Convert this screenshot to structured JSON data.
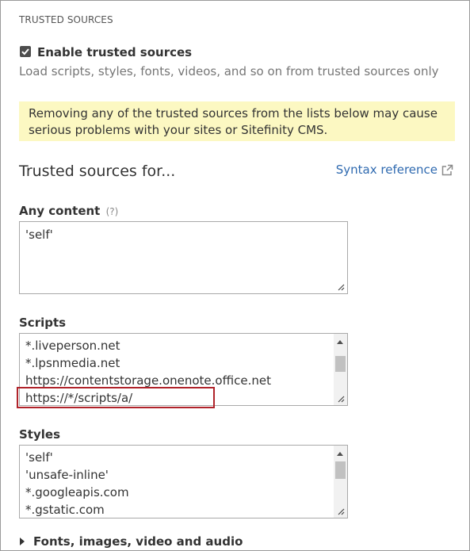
{
  "section_title": "TRUSTED SOURCES",
  "enable": {
    "label": "Enable trusted sources",
    "description": "Load scripts, styles, fonts, videos, and so on from trusted sources only",
    "checked": true
  },
  "warning": {
    "line1": "Removing any of the trusted sources from the lists below may cause",
    "line2": "serious problems with your sites or Sitefinity CMS."
  },
  "heading": "Trusted sources for...",
  "syntax_link": {
    "label": "Syntax reference",
    "icon": "external-link-icon"
  },
  "any_content": {
    "label": "Any content",
    "help": "(?)",
    "lines": [
      "'self'"
    ]
  },
  "scripts": {
    "label": "Scripts",
    "lines": [
      "*.liveperson.net",
      "*.lpsnmedia.net",
      "https://contentstorage.onenote.office.net",
      "https://*/scripts/a/"
    ]
  },
  "styles": {
    "label": "Styles",
    "lines": [
      "'self'",
      "'unsafe-inline'",
      "*.googleapis.com",
      "*.gstatic.com"
    ]
  },
  "fonts_section": {
    "label": "Fonts, images, video and audio",
    "icon": "caret-right-icon"
  },
  "colors": {
    "link": "#2f6ab0",
    "warning_bg": "#fcf8c2",
    "highlight": "#b0232a"
  }
}
